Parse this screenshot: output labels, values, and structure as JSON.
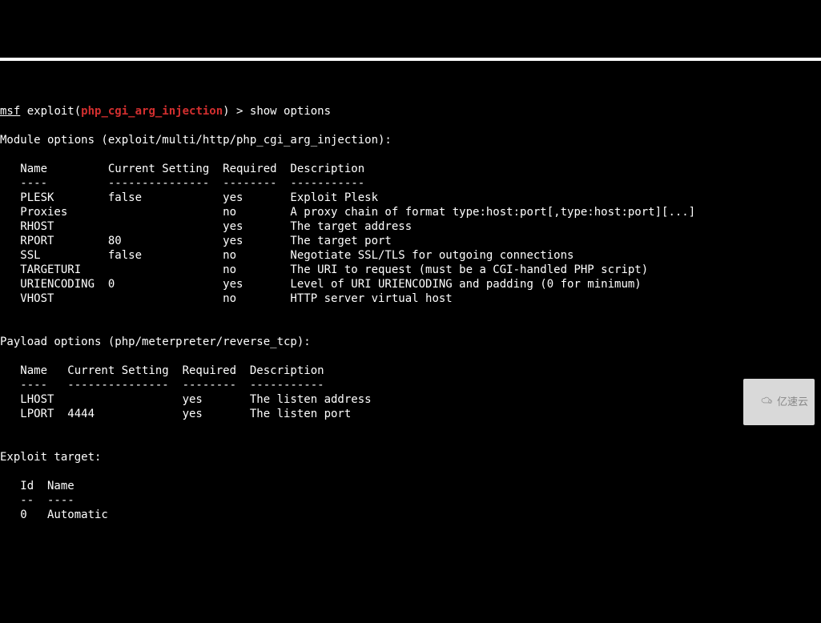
{
  "prompt": {
    "msf": "msf",
    "exploit_word": " exploit(",
    "module_short": "php_cgi_arg_injection",
    "close_paren": ") > ",
    "command": "show options"
  },
  "module_header": "Module options (exploit/multi/http/php_cgi_arg_injection):",
  "module_table": {
    "head": "   Name         Current Setting  Required  Description",
    "divider": "   ----         ---------------  --------  -----------",
    "rows": [
      "   PLESK        false            yes       Exploit Plesk",
      "   Proxies                       no        A proxy chain of format type:host:port[,type:host:port][...]",
      "   RHOST                         yes       The target address",
      "   RPORT        80               yes       The target port",
      "   SSL          false            no        Negotiate SSL/TLS for outgoing connections",
      "   TARGETURI                     no        The URI to request (must be a CGI-handled PHP script)",
      "   URIENCODING  0                yes       Level of URI URIENCODING and padding (0 for minimum)",
      "   VHOST                         no        HTTP server virtual host"
    ]
  },
  "payload_header": "Payload options (php/meterpreter/reverse_tcp):",
  "payload_table": {
    "head": "   Name   Current Setting  Required  Description",
    "divider": "   ----   ---------------  --------  -----------",
    "rows": [
      "   LHOST                   yes       The listen address",
      "   LPORT  4444             yes       The listen port"
    ]
  },
  "target_header": "Exploit target:",
  "target_table": {
    "head": "   Id  Name",
    "divider": "   --  ----",
    "rows": [
      "   0   Automatic"
    ]
  },
  "watermark": {
    "text": "亿速云"
  }
}
